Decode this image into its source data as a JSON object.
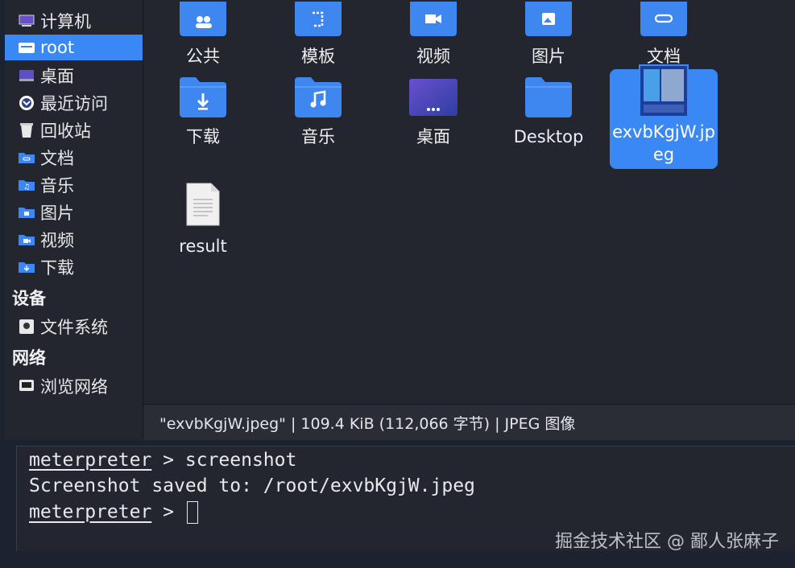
{
  "sidebar": {
    "items": [
      {
        "label": "计算机",
        "icon": "computer-icon"
      },
      {
        "label": "root",
        "icon": "home-folder-icon",
        "active": true
      },
      {
        "label": "桌面",
        "icon": "desktop-icon"
      },
      {
        "label": "最近访问",
        "icon": "recent-icon"
      },
      {
        "label": "回收站",
        "icon": "trash-icon"
      },
      {
        "label": "文档",
        "icon": "documents-folder-icon"
      },
      {
        "label": "音乐",
        "icon": "music-folder-icon"
      },
      {
        "label": "图片",
        "icon": "pictures-folder-icon"
      },
      {
        "label": "视频",
        "icon": "videos-folder-icon"
      },
      {
        "label": "下载",
        "icon": "downloads-folder-icon"
      }
    ],
    "devices_header": "设备",
    "devices": [
      {
        "label": "文件系统",
        "icon": "drive-icon"
      }
    ],
    "network_header": "网络",
    "network": [
      {
        "label": "浏览网络",
        "icon": "network-icon"
      }
    ]
  },
  "files": [
    {
      "label": "公共",
      "icon": "public-folder-icon"
    },
    {
      "label": "模板",
      "icon": "templates-folder-icon"
    },
    {
      "label": "视频",
      "icon": "videos-folder-icon"
    },
    {
      "label": "图片",
      "icon": "pictures-folder-icon"
    },
    {
      "label": "文档",
      "icon": "documents-folder-icon"
    },
    {
      "label": "下载",
      "icon": "downloads-folder-icon"
    },
    {
      "label": "音乐",
      "icon": "music-folder-icon"
    },
    {
      "label": "桌面",
      "icon": "desktop-folder-icon"
    },
    {
      "label": "Desktop",
      "icon": "folder-icon"
    },
    {
      "label": "exvbKgjW.jpeg",
      "icon": "image-thumbnail-icon",
      "selected": true
    },
    {
      "label": "result",
      "icon": "text-file-icon"
    }
  ],
  "status": "\"exvbKgjW.jpeg\" | 109.4 KiB (112,066 字节) | JPEG 图像",
  "terminal": {
    "prompt": "meterpreter",
    "line1_cmd": " > screenshot",
    "line2": "Screenshot saved to: /root/exvbKgjW.jpeg",
    "line3_suffix": " > "
  },
  "watermark": "掘金技术社区 @ 鄙人张麻子",
  "colors": {
    "accent": "#3a88f4",
    "folder": "#3f87f0",
    "background": "#23262e"
  }
}
